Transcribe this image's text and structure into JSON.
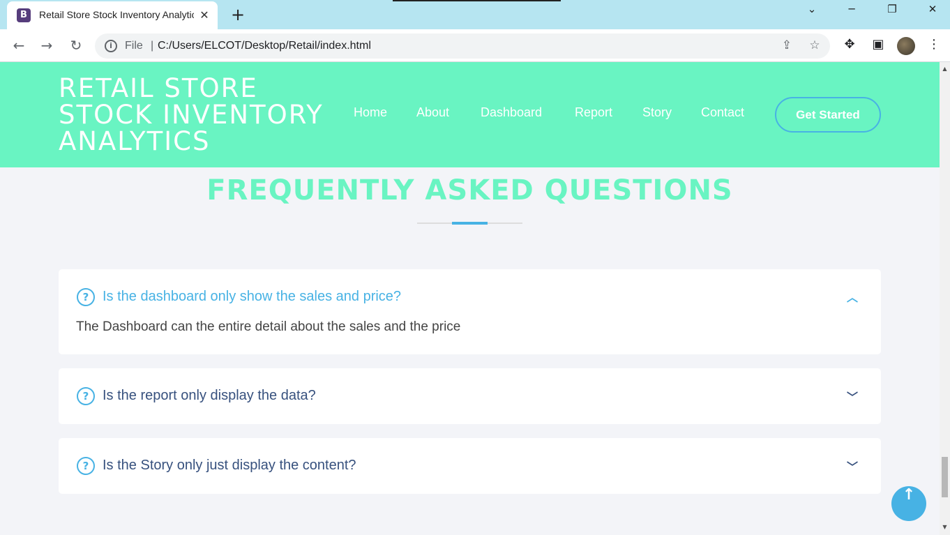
{
  "browser": {
    "tab_title": "Retail Store Stock Inventory Analytics",
    "favicon_letter": "B",
    "url_scheme": "File",
    "url": "C:/Users/ELCOT/Desktop/Retail/index.html"
  },
  "header": {
    "logo_lines": [
      "RETAIL STORE",
      "STOCK INVENTORY",
      "ANALYTICS"
    ],
    "nav": [
      "Home",
      "About",
      "Dashboard",
      "Report",
      "Story",
      "Contact"
    ],
    "cta_label": "Get Started"
  },
  "faq": {
    "title": "FREQUENTLY ASKED QUESTIONS",
    "items": [
      {
        "question": "Is the dashboard only show the sales and price?",
        "answer": "The Dashboard can the entire detail about the sales and the price",
        "expanded": true
      },
      {
        "question": "Is the report only display the data?",
        "expanded": false
      },
      {
        "question": "Is the Story only just display the content?",
        "expanded": false
      }
    ]
  },
  "colors": {
    "header_bg": "#69f4c2",
    "accent": "#47b2e4",
    "heading": "#37517e",
    "page_bg": "#f3f4f8"
  },
  "icons": {
    "question": "question-circle-icon",
    "expand": "chevron-down-icon",
    "collapse": "chevron-up-icon",
    "back_to_top": "arrow-up-icon"
  }
}
